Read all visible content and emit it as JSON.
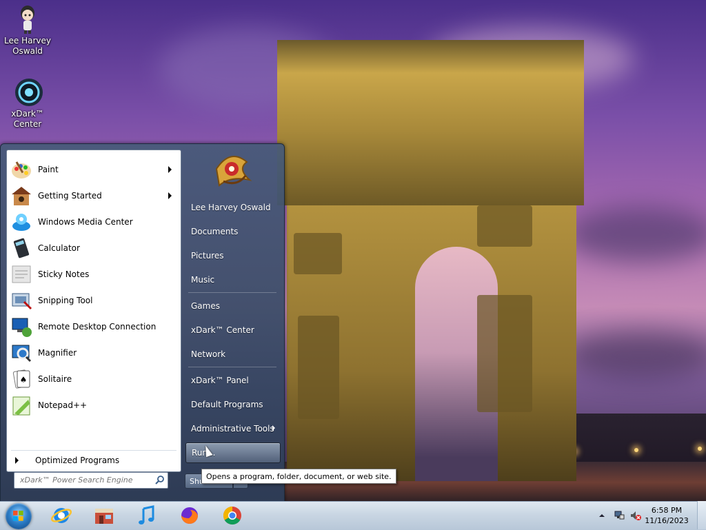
{
  "desktop": {
    "icons": [
      {
        "label": "Lee Harvey Oswald",
        "icon": "user-doll-icon"
      },
      {
        "label": "xDark™ Center",
        "icon": "xdark-center-icon"
      }
    ]
  },
  "start_menu": {
    "programs": [
      {
        "label": "Paint",
        "icon": "paint-icon",
        "has_submenu": true
      },
      {
        "label": "Getting Started",
        "icon": "getting-started-icon",
        "has_submenu": true
      },
      {
        "label": "Windows Media Center",
        "icon": "media-center-icon",
        "has_submenu": false
      },
      {
        "label": "Calculator",
        "icon": "calculator-icon",
        "has_submenu": false
      },
      {
        "label": "Sticky Notes",
        "icon": "sticky-notes-icon",
        "has_submenu": false
      },
      {
        "label": "Snipping Tool",
        "icon": "snipping-tool-icon",
        "has_submenu": false
      },
      {
        "label": "Remote Desktop Connection",
        "icon": "remote-desktop-icon",
        "has_submenu": false
      },
      {
        "label": "Magnifier",
        "icon": "magnifier-icon",
        "has_submenu": false
      },
      {
        "label": "Solitaire",
        "icon": "solitaire-icon",
        "has_submenu": false
      },
      {
        "label": "Notepad++",
        "icon": "notepad-plus-plus-icon",
        "has_submenu": false
      }
    ],
    "all_programs_label": "Optimized Programs",
    "search_placeholder": "xDark™ Power Search Engine",
    "right_items": [
      {
        "label": "Lee Harvey Oswald"
      },
      {
        "label": "Documents"
      },
      {
        "label": "Pictures"
      },
      {
        "label": "Music"
      },
      {
        "label": "Games"
      },
      {
        "label": "xDark™ Center"
      },
      {
        "label": "Network"
      },
      {
        "label": "xDark™ Panel"
      },
      {
        "label": "Default Programs"
      },
      {
        "label": "Administrative Tools",
        "has_submenu": true
      },
      {
        "label": "Run...",
        "highlighted": true
      }
    ],
    "shutdown_label": "Shut down",
    "tooltip": "Opens a program, folder, document, or web site."
  },
  "taskbar": {
    "apps": [
      {
        "icon": "internet-explorer-icon"
      },
      {
        "icon": "store-icon"
      },
      {
        "icon": "itunes-icon"
      },
      {
        "icon": "firefox-icon"
      },
      {
        "icon": "chrome-icon"
      }
    ],
    "clock": {
      "time": "6:58 PM",
      "date": "11/16/2023"
    }
  }
}
